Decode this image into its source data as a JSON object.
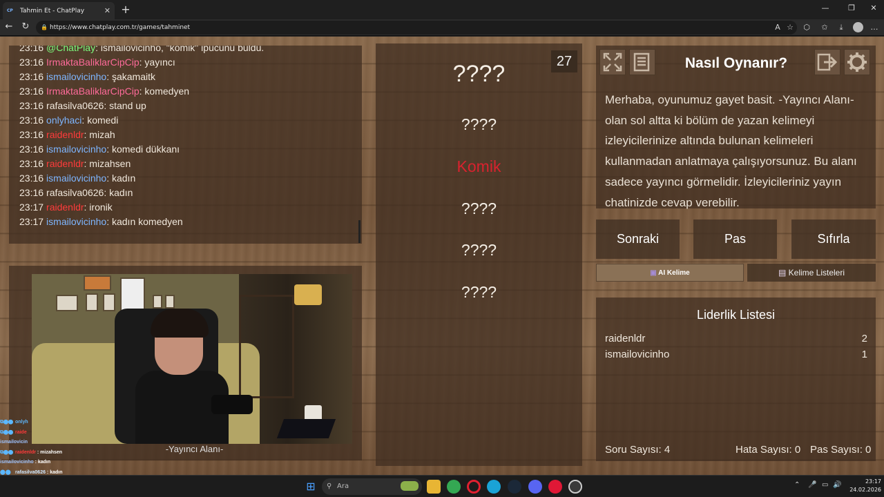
{
  "browser": {
    "tab_title": "Tahmin Et - ChatPlay",
    "tab_favicon": "CP",
    "url": "https://www.chatplay.com.tr/games/tahminet"
  },
  "chat": {
    "lines": [
      {
        "time": "23:16",
        "user": "@ChatPlay",
        "msg": ": ismailovicinho, \"komik\" ipucunu buldu.",
        "color": "green"
      },
      {
        "time": "23:16",
        "user": "IrmaktaBaliklarCipCip",
        "msg": ": yayıncı",
        "color": "pink"
      },
      {
        "time": "23:16",
        "user": "ismailovicinho",
        "msg": ": şakamaitk",
        "color": "blue"
      },
      {
        "time": "23:16",
        "user": "IrmaktaBaliklarCipCip",
        "msg": ": komedyen",
        "color": "pink"
      },
      {
        "time": "23:16",
        "user": "rafasilva0626",
        "msg": ": stand up",
        "color": "white"
      },
      {
        "time": "23:16",
        "user": "onlyhaci",
        "msg": ": komedi",
        "color": "blue"
      },
      {
        "time": "23:16",
        "user": "raidenldr",
        "msg": ": mizah",
        "color": "red"
      },
      {
        "time": "23:16",
        "user": "ismailovicinho",
        "msg": ": komedi dükkanı",
        "color": "blue"
      },
      {
        "time": "23:16",
        "user": "raidenldr",
        "msg": ": mizahsen",
        "color": "red"
      },
      {
        "time": "23:16",
        "user": "ismailovicinho",
        "msg": ": kadın",
        "color": "blue"
      },
      {
        "time": "23:16",
        "user": "rafasilva0626",
        "msg": ": kadın",
        "color": "white"
      },
      {
        "time": "23:17",
        "user": "raidenldr",
        "msg": ": ironik",
        "color": "red"
      },
      {
        "time": "23:17",
        "user": "ismailovicinho",
        "msg": ": kadın komedyen",
        "color": "blue"
      }
    ]
  },
  "camera_label": "-Yayıncı Alanı-",
  "overlay_chat": [
    {
      "user": "onlyh",
      "msg": ""
    },
    {
      "user": "raide",
      "msg": ""
    },
    {
      "user": "ismailovicin",
      "msg": ""
    },
    {
      "user": "raidenldr",
      "msg": " : mizahsen"
    },
    {
      "user": "ismailovicinho",
      "msg": " : kadın"
    },
    {
      "user": "rafasilva0626",
      "msg": " : kadın"
    },
    {
      "user": "raidenldr",
      "msg": " : ironik"
    },
    {
      "user": "ismailovicinho",
      "msg": " : kadın komedyen"
    }
  ],
  "words": {
    "timer": "27",
    "items": [
      "????",
      "????",
      "Komik",
      "????",
      "????",
      "????"
    ]
  },
  "howto": {
    "title": "Nasıl Oynanır?",
    "text": "Merhaba, oyunumuz gayet basit. -Yayıncı Alanı- olan sol altta ki bölüm de yazan kelimeyi izleyicilerinize altında bulunan kelimeleri kullanmadan anlatmaya çalışıyorsunuz. Bu alanı sadece yayıncı görmelidir. İzleyicileriniz yayın chatinizde cevap verebilir."
  },
  "actions": {
    "next": "Sonraki",
    "pass": "Pas",
    "reset": "Sıfırla",
    "ai_words": "AI Kelime",
    "word_lists": "Kelime Listeleri"
  },
  "leaderboard": {
    "title": "Liderlik Listesi",
    "rows": [
      {
        "name": "raidenldr",
        "score": "2"
      },
      {
        "name": "ismailovicinho",
        "score": "1"
      }
    ],
    "question_count": "Soru Sayısı: 4",
    "error_count": "Hata Sayısı: 0",
    "pass_count": "Pas Sayısı: 0"
  },
  "taskbar": {
    "search_placeholder": "Ara",
    "time": "23:17",
    "date": "24.02.2026"
  },
  "colors": {
    "green": "#7dfc7d",
    "pink": "#ff6b9a",
    "blue": "#7eb6ff",
    "red": "#ff3b3b",
    "white": "#f1e8dc"
  }
}
